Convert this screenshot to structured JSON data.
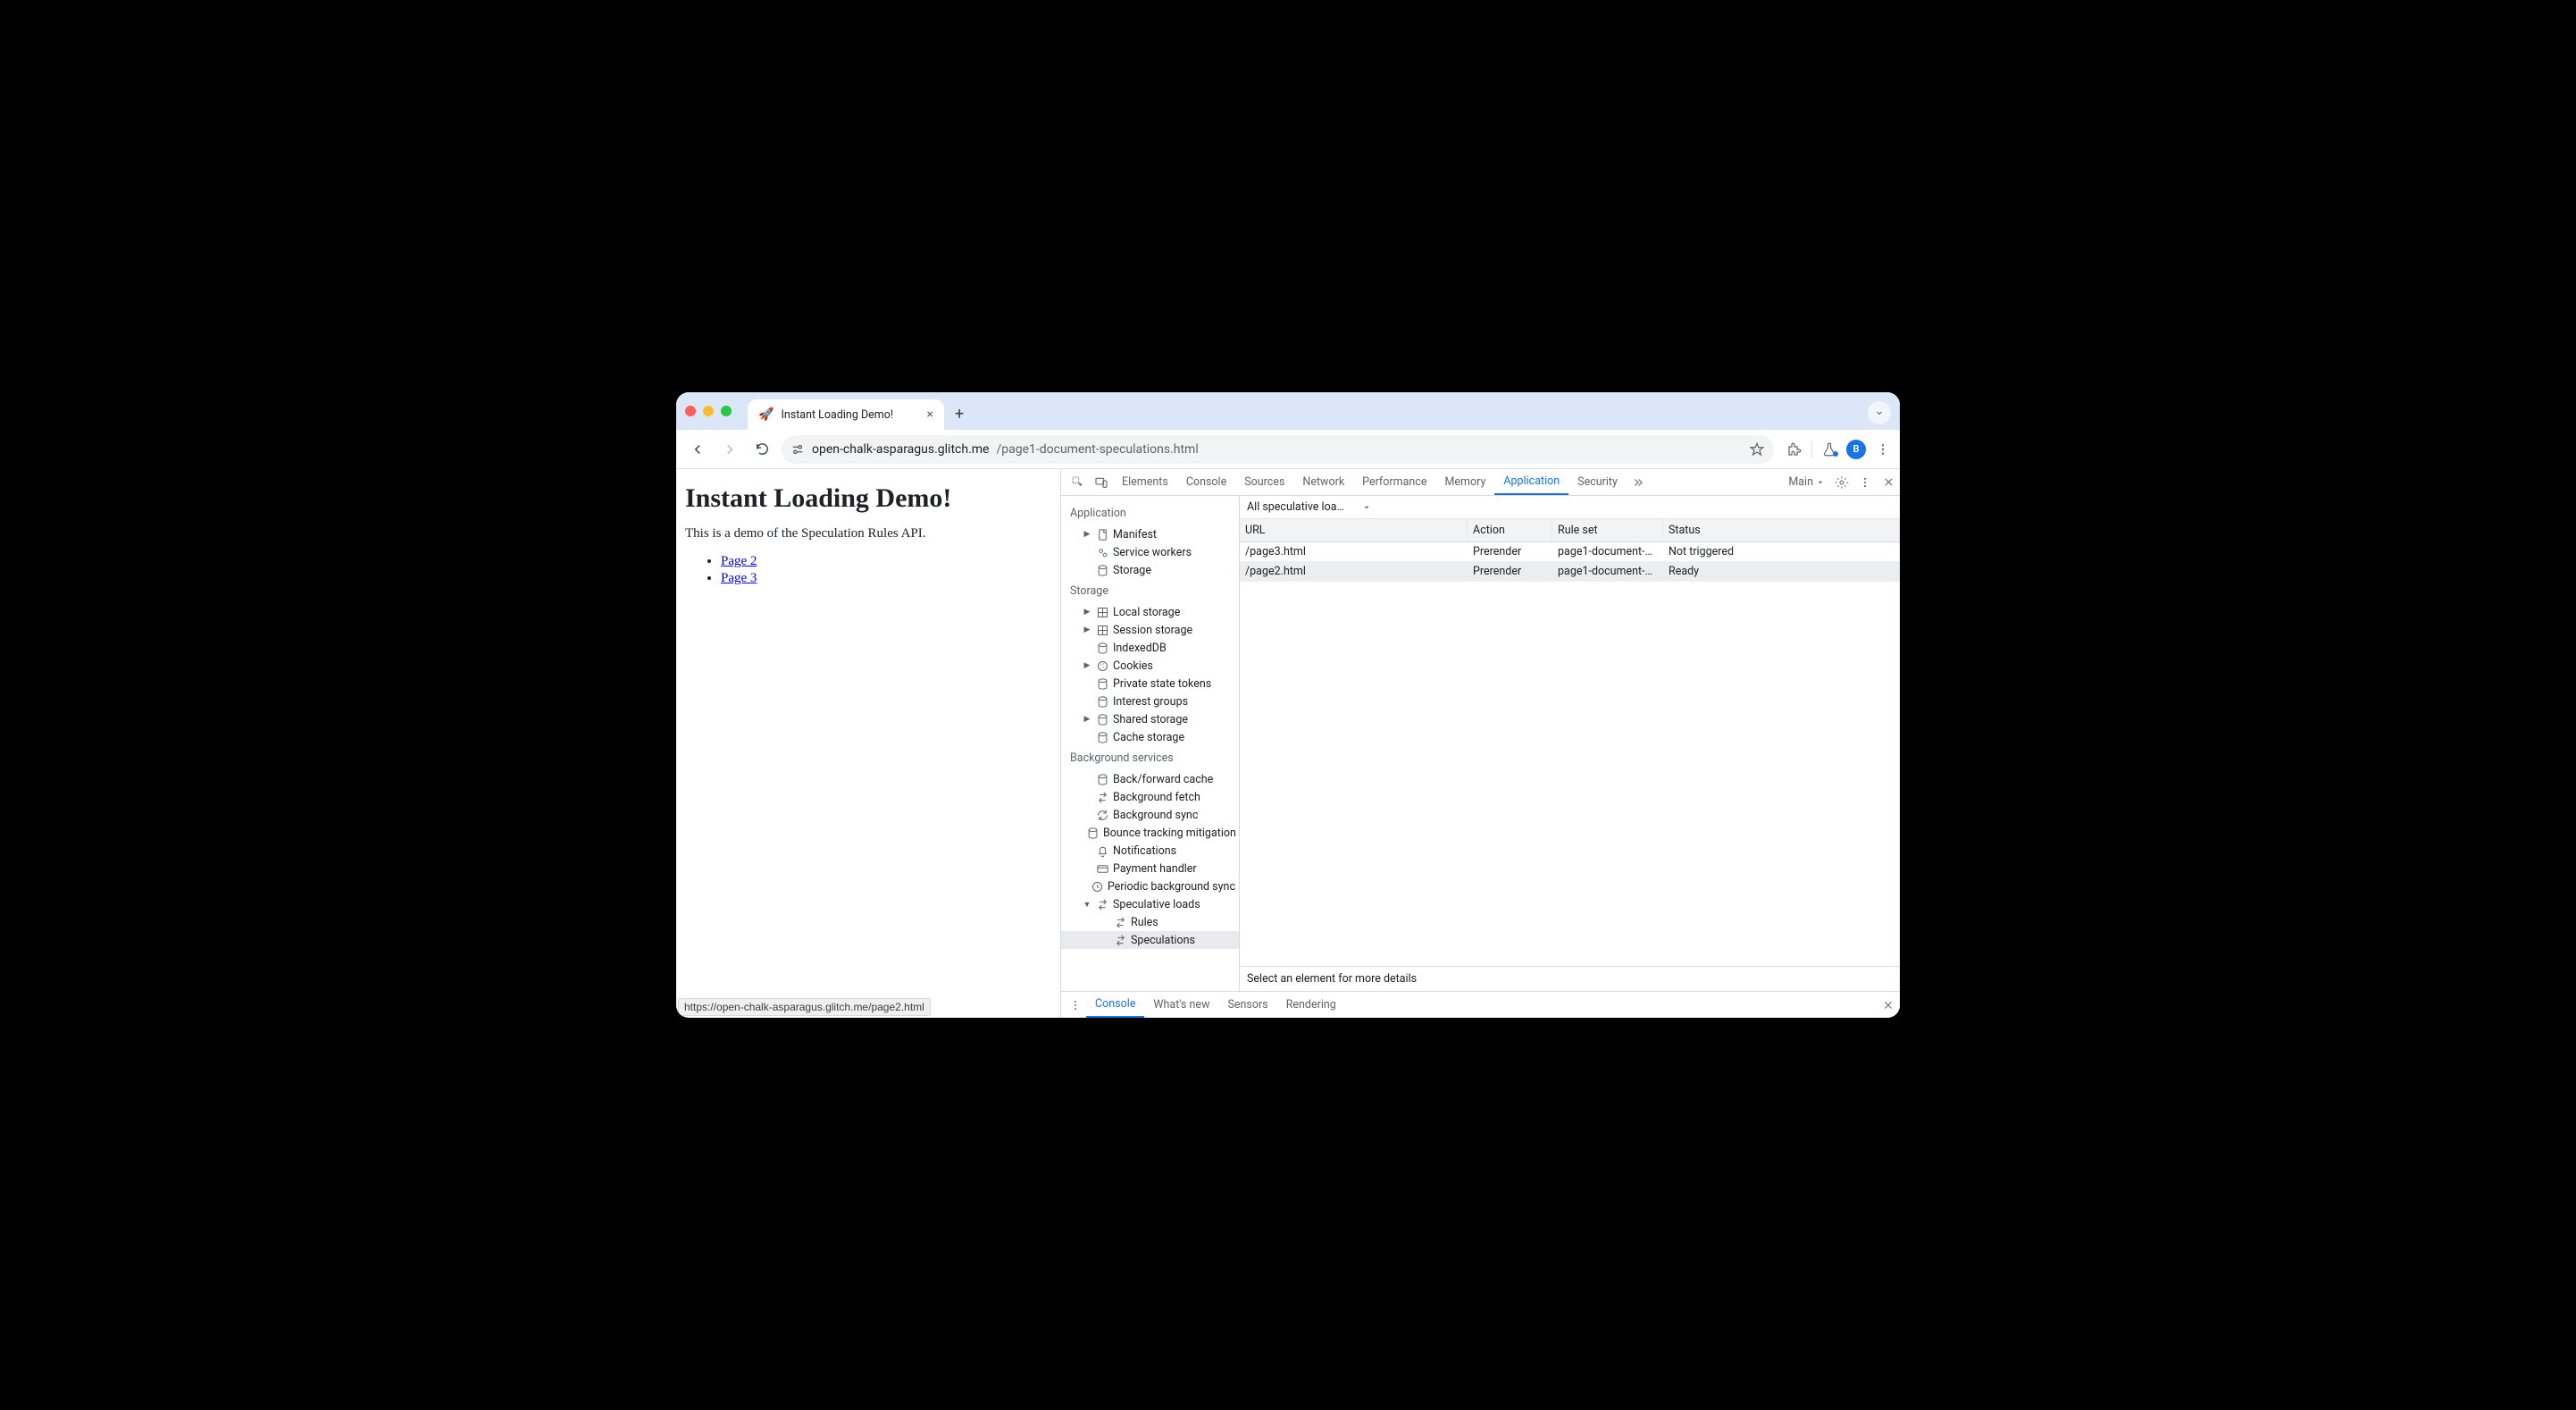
{
  "browser": {
    "tab_emoji": "🚀",
    "tab_title": "Instant Loading Demo!",
    "url_host": "open-chalk-asparagus.glitch.me",
    "url_path": "/page1-document-speculations.html",
    "avatar_letter": "B",
    "status_url": "https://open-chalk-asparagus.glitch.me/page2.html"
  },
  "page": {
    "heading": "Instant Loading Demo!",
    "intro": "This is a demo of the Speculation Rules API.",
    "links": [
      "Page 2",
      "Page 3"
    ]
  },
  "devtools": {
    "tabs": [
      "Elements",
      "Console",
      "Sources",
      "Network",
      "Performance",
      "Memory",
      "Application",
      "Security"
    ],
    "active_tab": "Application",
    "frame_label": "Main",
    "sidebar": {
      "groups": [
        {
          "title": "Application",
          "items": [
            {
              "label": "Manifest",
              "icon": "file",
              "expand": true
            },
            {
              "label": "Service workers",
              "icon": "gears"
            },
            {
              "label": "Storage",
              "icon": "db"
            }
          ]
        },
        {
          "title": "Storage",
          "items": [
            {
              "label": "Local storage",
              "icon": "grid",
              "expand": true
            },
            {
              "label": "Session storage",
              "icon": "grid",
              "expand": true
            },
            {
              "label": "IndexedDB",
              "icon": "db"
            },
            {
              "label": "Cookies",
              "icon": "cookie",
              "expand": true
            },
            {
              "label": "Private state tokens",
              "icon": "db"
            },
            {
              "label": "Interest groups",
              "icon": "db"
            },
            {
              "label": "Shared storage",
              "icon": "db",
              "expand": true
            },
            {
              "label": "Cache storage",
              "icon": "db"
            }
          ]
        },
        {
          "title": "Background services",
          "items": [
            {
              "label": "Back/forward cache",
              "icon": "db"
            },
            {
              "label": "Background fetch",
              "icon": "swap"
            },
            {
              "label": "Background sync",
              "icon": "sync"
            },
            {
              "label": "Bounce tracking mitigation",
              "icon": "db"
            },
            {
              "label": "Notifications",
              "icon": "bell"
            },
            {
              "label": "Payment handler",
              "icon": "card"
            },
            {
              "label": "Periodic background sync",
              "icon": "clock"
            },
            {
              "label": "Speculative loads",
              "icon": "swap",
              "expand": true,
              "open": true,
              "children": [
                {
                  "label": "Rules",
                  "icon": "swap"
                },
                {
                  "label": "Speculations",
                  "icon": "swap",
                  "selected": true
                }
              ]
            }
          ]
        }
      ]
    },
    "filter_label": "All speculative loa…",
    "columns": [
      "URL",
      "Action",
      "Rule set",
      "Status"
    ],
    "rows": [
      {
        "url": "/page3.html",
        "action": "Prerender",
        "ruleset": "page1-document-…",
        "status": "Not triggered"
      },
      {
        "url": "/page2.html",
        "action": "Prerender",
        "ruleset": "page1-document-…",
        "status": "Ready",
        "selected": true
      }
    ],
    "detail_hint": "Select an element for more details",
    "drawer_tabs": [
      "Console",
      "What's new",
      "Sensors",
      "Rendering"
    ],
    "drawer_active": "Console"
  }
}
